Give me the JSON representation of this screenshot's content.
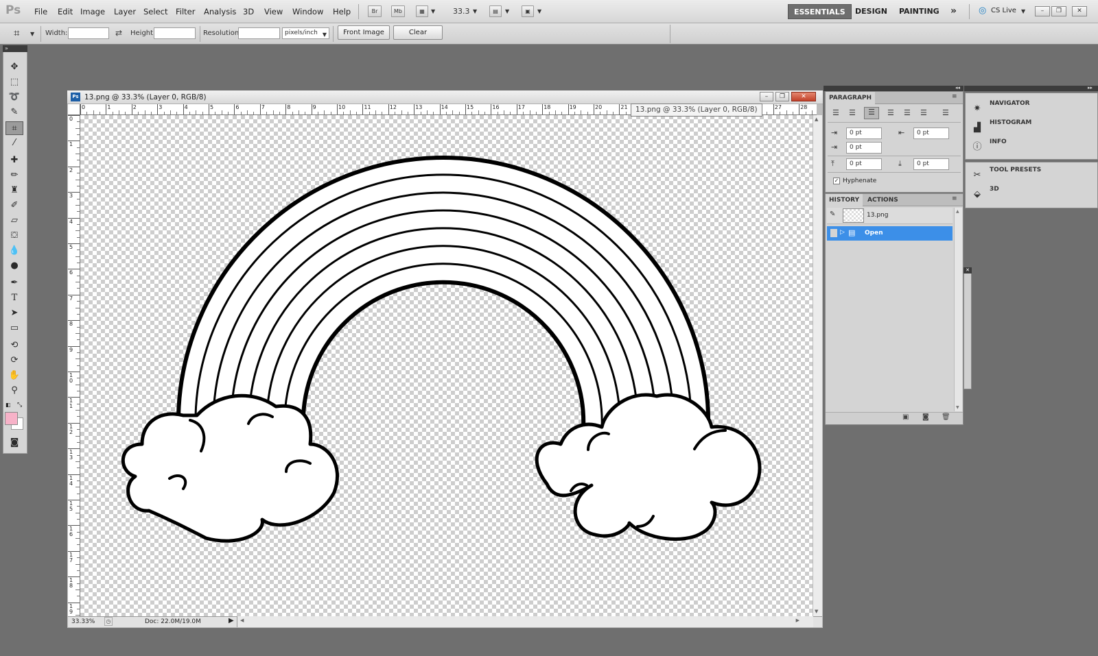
{
  "app": {
    "logo": "Ps"
  },
  "menu": [
    "File",
    "Edit",
    "Image",
    "Layer",
    "Select",
    "Filter",
    "Analysis",
    "3D",
    "View",
    "Window",
    "Help"
  ],
  "appbar": {
    "br": "Br",
    "mb": "Mb",
    "zoom": "33.3"
  },
  "workspaces": [
    "ESSENTIALS",
    "DESIGN",
    "PAINTING"
  ],
  "more_workspaces": "»",
  "cslive": "CS Live",
  "options": {
    "width_label": "Width:",
    "height_label": "Height:",
    "resolution_label": "Resolution:",
    "units": "pixels/inch",
    "front_image": "Front Image",
    "clear": "Clear"
  },
  "document": {
    "title": "13.png @ 33.3% (Layer 0, RGB/8)",
    "tooltip": "13.png @ 33.3% (Layer 0, RGB/8)",
    "zoom": "33.33%",
    "doc_size": "Doc: 22.0M/19.0M",
    "hruler": [
      "0",
      "1",
      "2",
      "3",
      "4",
      "5",
      "6",
      "7",
      "8",
      "9",
      "10",
      "11",
      "12",
      "13",
      "14",
      "15",
      "16",
      "17",
      "18",
      "19",
      "20",
      "21",
      "22",
      "23",
      "24",
      "25",
      "26",
      "27",
      "28"
    ],
    "vruler": [
      "0",
      "1",
      "2",
      "3",
      "4",
      "5",
      "6",
      "7",
      "8",
      "9",
      "10",
      "11",
      "12",
      "13",
      "14",
      "15",
      "16",
      "17",
      "18",
      "19"
    ]
  },
  "paragraph": {
    "title": "PARAGRAPH",
    "indent_left": "0 pt",
    "indent_right": "0 pt",
    "first_line": "0 pt",
    "space_before": "0 pt",
    "space_after": "0 pt",
    "hyphenate": "Hyphenate",
    "hyphenate_checked": true
  },
  "history": {
    "tabs": [
      "HISTORY",
      "ACTIONS"
    ],
    "snapshot": "13.png",
    "items": [
      "Open"
    ],
    "selected_color": "#3c8fe8"
  },
  "dock": {
    "group1": [
      "NAVIGATOR",
      "HISTOGRAM",
      "INFO"
    ],
    "group2": [
      "TOOL PRESETS",
      "3D"
    ]
  },
  "colors": {
    "foreground": "#f7b2c8",
    "background": "#ffffff",
    "accent": "#3c8fe8"
  },
  "icons": {
    "tools": [
      "move-icon",
      "marquee-icon",
      "lasso-icon",
      "quick-select-icon",
      "crop-icon",
      "eyedropper-icon",
      "healing-brush-icon",
      "brush-icon",
      "clone-stamp-icon",
      "history-brush-icon",
      "eraser-icon",
      "paint-bucket-icon",
      "blur-icon",
      "dodge-icon",
      "pen-icon",
      "type-icon",
      "path-select-icon",
      "shape-icon",
      "3d-rotate-icon",
      "3d-orbit-icon",
      "hand-icon",
      "zoom-icon"
    ]
  }
}
